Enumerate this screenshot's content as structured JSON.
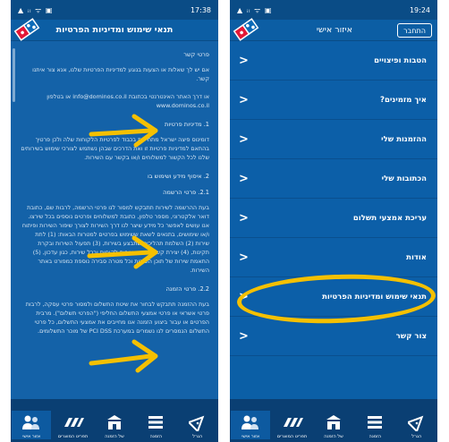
{
  "left": {
    "status": {
      "time": "17:38",
      "icons": "▲ ᵢₗ ᯤ ▣"
    },
    "title": "תנאי שימוש ומדיניות הפרטיות",
    "sections": [
      {
        "heading": "פרטי קשר",
        "body": "אם יש לך שאלות או הצעות בנוגע למדיניות הפרטיות שלנו, אנא צור איתנו קשר."
      },
      {
        "heading": "",
        "body": "או דרך האתר האינטרנטי בכתובת info@dominos.co.il או בטלפון www.dominos.co.il"
      },
      {
        "heading": "1. מדיניות פרטיות",
        "body": "דומינוס פיצה ישראל מתחייבת בכבוד לפרטיות הלקוחות שלה ולכן פרטיך בהתאם למדיניות פרטיות זו ואת הדרכים שבהן נשתמש לצורכי שימוש בשירותים שלנו לכל הקשור למשלוחים ו/או בקשר עם השירות."
      },
      {
        "heading": "2. איסוף מידע ושימוש בו",
        "body": ""
      },
      {
        "heading": "2.1. פרטי הרשמה",
        "body": "בעת ההרשמה לשירות תתבקש למסור לנו פרטי הרשמה, לרבות שם, כתובת דואר אלקטרוני, מספר טלפון, כתובת למשלוחים ופרטים נוספים בכל שירצו. אנו עושים לאפשר כל מידע שיצר לנו דרך השירות לצורך שיפור השירות ופיתוח ו/או שימושים, בתנאים לשאת ששימוש בפרטים למטרות הבאות: (1) לתת שירות (2) השלמת תהליכים שתבצע בשירות, (3) תפעול השירות ובקרת תקינות, (4) יצירת קשר לצורכי שירות לקוחות ובכל שירות, כגון עדכון, (5) התאמת שירות של תוכן השירות וכל מטרה סבירה נוספת כמפורט באתר השירות."
      },
      {
        "heading": "2.2. פרטי הזמנה",
        "body": "בעת ההזמנה תתבקש לבחור את שיטת התשלום ולמסור פרטי עסקה, לרבות פרטי אשראי או פרטי אמצעי התשלום החליפי (\"הפרטי תשלום\"). מרבית הפרטים או עבור ביצוע הזמנה אנו מחייבים את אמצעי התשלום, כל פרטי התשלום הנמסרים לנו נשמרים במערכת PCI DSS של מוכר התשלומים."
      }
    ],
    "tabs": [
      {
        "label": "אזור אישי",
        "icon": "person-icon"
      },
      {
        "label": "תפריט המוצרים",
        "icon": "pizza-menu-icon"
      },
      {
        "label": "של הזמנה",
        "icon": "store-icon"
      },
      {
        "label": "הזמנה",
        "icon": "list-icon"
      },
      {
        "label": "הגרל",
        "icon": "pizza-slice-icon"
      }
    ]
  },
  "right": {
    "status": {
      "time": "19:24",
      "icons": "▲ ᵢₗ ᯤ ▣"
    },
    "title": "איזור אישי",
    "login_label": "התחבר",
    "menu": [
      {
        "label": "הטבות ופיצויים"
      },
      {
        "label": "איך מזמינים?"
      },
      {
        "label": "ההזמנות שלי"
      },
      {
        "label": "הכתובות שלי"
      },
      {
        "label": "עריכת אמצעי תשלום"
      },
      {
        "label": "אודות"
      },
      {
        "label": "תנאי שימוש ומדיניות הפרטיות"
      },
      {
        "label": "צור קשר"
      }
    ],
    "tabs": [
      {
        "label": "אזור אישי",
        "icon": "person-icon"
      },
      {
        "label": "תפריט המוצרים",
        "icon": "pizza-menu-icon"
      },
      {
        "label": "של הזמנה",
        "icon": "store-icon"
      },
      {
        "label": "הזמנה",
        "icon": "list-icon"
      },
      {
        "label": "הגרל",
        "icon": "pizza-slice-icon"
      }
    ]
  },
  "colors": {
    "brand_blue": "#0b5fa6",
    "highlight_yellow": "#f5c000"
  }
}
